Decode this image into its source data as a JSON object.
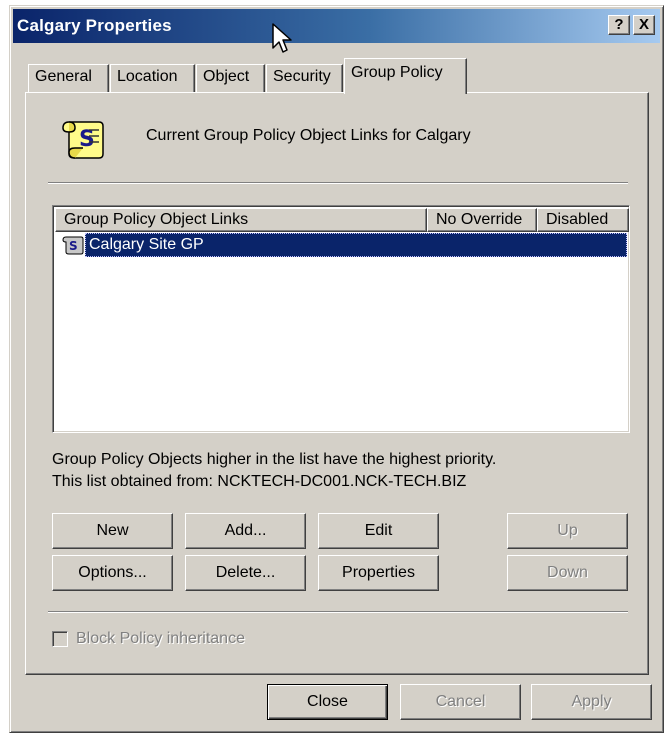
{
  "window": {
    "title": "Calgary Properties",
    "help_button": "?",
    "close_button": "X"
  },
  "tabs": [
    {
      "label": "General",
      "active": false
    },
    {
      "label": "Location",
      "active": false
    },
    {
      "label": "Object",
      "active": false
    },
    {
      "label": "Security",
      "active": false
    },
    {
      "label": "Group Policy",
      "active": true
    }
  ],
  "panel": {
    "heading": "Current Group Policy Object Links for Calgary",
    "icon": "scroll-icon",
    "list": {
      "columns": [
        "Group Policy Object Links",
        "No Override",
        "Disabled"
      ],
      "rows": [
        {
          "name": "Calgary Site GP",
          "no_override": "",
          "disabled": "",
          "selected": true
        }
      ]
    },
    "priority_note": "Group Policy Objects higher in the list have the highest priority.",
    "obtained_from": "This list obtained from: NCKTECH-DC001.NCK-TECH.BIZ",
    "buttons": {
      "new": "New",
      "add": "Add...",
      "edit": "Edit",
      "up": "Up",
      "options": "Options...",
      "delete": "Delete...",
      "properties": "Properties",
      "down": "Down"
    },
    "block_inheritance": {
      "label": "Block Policy inheritance",
      "checked": false,
      "enabled": false
    }
  },
  "footer_buttons": {
    "close": "Close",
    "cancel": "Cancel",
    "apply": "Apply"
  },
  "colors": {
    "dialog_face": "#d4d0c8",
    "titlebar_start": "#0a246a",
    "titlebar_end": "#a6caf0",
    "selection": "#0a246a"
  }
}
